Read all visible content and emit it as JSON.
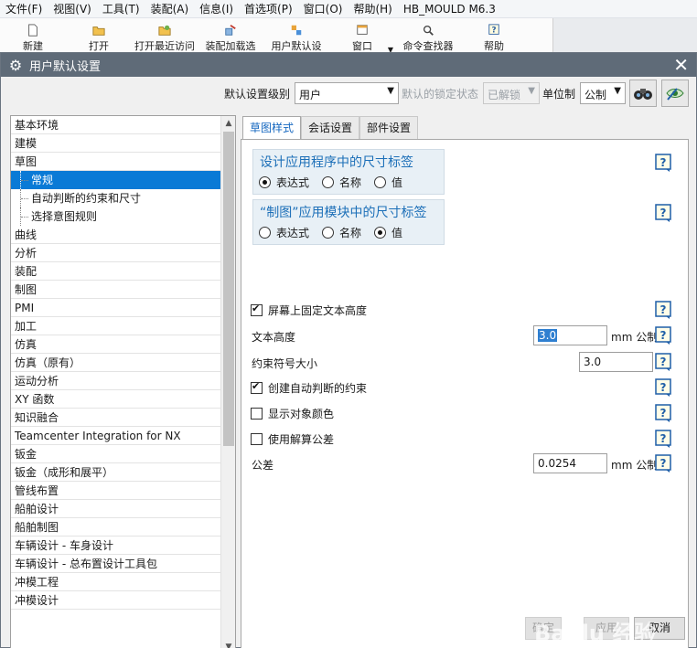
{
  "menubar": {
    "items": [
      "文件(F)",
      "视图(V)",
      "工具(T)",
      "装配(A)",
      "信息(I)",
      "首选项(P)",
      "窗口(O)",
      "帮助(H)"
    ],
    "app_title": "HB_MOULD M6.3"
  },
  "toolbar": {
    "items": [
      "新建",
      "打开",
      "打开最近访问",
      "装配加载选",
      "用户默认设",
      "窗口",
      "命令查找器",
      "帮助"
    ]
  },
  "dialog": {
    "title": "用户默认设置",
    "settings": {
      "level_label": "默认设置级别",
      "level_value": "用户",
      "lock_label": "默认的锁定状态",
      "lock_value": "已解锁",
      "unit_label": "单位制",
      "unit_value": "公制"
    },
    "tree": [
      {
        "label": "基本环境",
        "sub": false,
        "selected": false
      },
      {
        "label": "建模",
        "sub": false,
        "selected": false
      },
      {
        "label": "草图",
        "sub": false,
        "selected": false
      },
      {
        "label": "常规",
        "sub": true,
        "selected": true
      },
      {
        "label": "自动判断的约束和尺寸",
        "sub": true,
        "selected": false
      },
      {
        "label": "选择意图规则",
        "sub": true,
        "selected": false
      },
      {
        "label": "曲线",
        "sub": false,
        "selected": false
      },
      {
        "label": "分析",
        "sub": false,
        "selected": false
      },
      {
        "label": "装配",
        "sub": false,
        "selected": false
      },
      {
        "label": "制图",
        "sub": false,
        "selected": false
      },
      {
        "label": "PMI",
        "sub": false,
        "selected": false
      },
      {
        "label": "加工",
        "sub": false,
        "selected": false
      },
      {
        "label": "仿真",
        "sub": false,
        "selected": false
      },
      {
        "label": "仿真（原有）",
        "sub": false,
        "selected": false
      },
      {
        "label": "运动分析",
        "sub": false,
        "selected": false
      },
      {
        "label": "XY 函数",
        "sub": false,
        "selected": false
      },
      {
        "label": "知识融合",
        "sub": false,
        "selected": false
      },
      {
        "label": "Teamcenter Integration for NX",
        "sub": false,
        "selected": false
      },
      {
        "label": "钣金",
        "sub": false,
        "selected": false
      },
      {
        "label": "钣金（成形和展平）",
        "sub": false,
        "selected": false
      },
      {
        "label": "管线布置",
        "sub": false,
        "selected": false
      },
      {
        "label": "船舶设计",
        "sub": false,
        "selected": false
      },
      {
        "label": "船舶制图",
        "sub": false,
        "selected": false
      },
      {
        "label": "车辆设计 - 车身设计",
        "sub": false,
        "selected": false
      },
      {
        "label": "车辆设计 - 总布置设计工具包",
        "sub": false,
        "selected": false
      },
      {
        "label": "冲模工程",
        "sub": false,
        "selected": false
      },
      {
        "label": "冲模设计",
        "sub": false,
        "selected": false
      }
    ],
    "tabs": [
      "草图样式",
      "会话设置",
      "部件设置"
    ],
    "panel": {
      "group1": {
        "title": "设计应用程序中的尺寸标签",
        "options": [
          "表达式",
          "名称",
          "值"
        ],
        "selected": 0
      },
      "group2": {
        "title": "“制图”应用模块中的尺寸标签",
        "options": [
          "表达式",
          "名称",
          "值"
        ],
        "selected": 2
      },
      "fixed_text_height": {
        "label": "屏幕上固定文本高度",
        "checked": true
      },
      "text_height": {
        "label": "文本高度",
        "value": "3.0",
        "unit": "mm 公制"
      },
      "constraint_symbol_size": {
        "label": "约束符号大小",
        "value": "3.0"
      },
      "create_inferred": {
        "label": "创建自动判断的约束",
        "checked": true
      },
      "show_object_color": {
        "label": "显示对象颜色",
        "checked": false
      },
      "use_solution_tolerance": {
        "label": "使用解算公差",
        "checked": false
      },
      "tolerance": {
        "label": "公差",
        "value": "0.0254",
        "unit": "mm 公制"
      }
    },
    "buttons": {
      "ok": "确定",
      "apply": "应用",
      "cancel": "取消"
    }
  },
  "watermark": {
    "logo": "Baidu 经验",
    "url": "jingyan.baidu.com"
  },
  "colors": {
    "titlebar": "#5f6b78",
    "selection": "#0a7ad6",
    "group_bg": "#e8f0f6",
    "group_title": "#1c6fb8"
  }
}
